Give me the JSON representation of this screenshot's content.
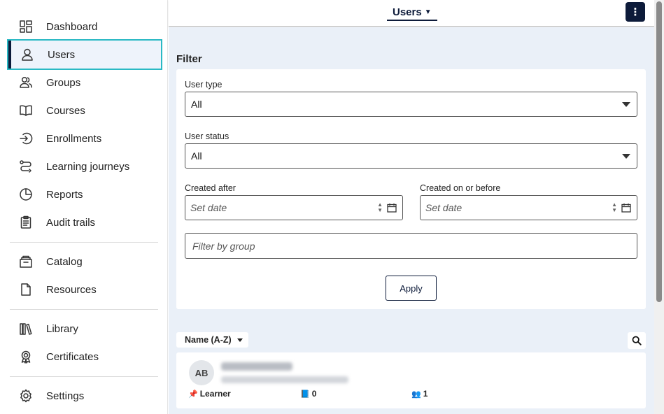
{
  "sidebar": {
    "items": [
      {
        "label": "Dashboard",
        "icon": "dashboard-icon"
      },
      {
        "label": "Users",
        "icon": "user-icon",
        "active": true
      },
      {
        "label": "Groups",
        "icon": "groups-icon"
      },
      {
        "label": "Courses",
        "icon": "book-icon"
      },
      {
        "label": "Enrollments",
        "icon": "enroll-icon"
      },
      {
        "label": "Learning journeys",
        "icon": "journey-icon"
      },
      {
        "label": "Reports",
        "icon": "pie-chart-icon"
      },
      {
        "label": "Audit trails",
        "icon": "clipboard-icon"
      },
      {
        "label": "Catalog",
        "icon": "catalog-icon"
      },
      {
        "label": "Resources",
        "icon": "file-icon"
      },
      {
        "label": "Library",
        "icon": "library-icon"
      },
      {
        "label": "Certificates",
        "icon": "certificate-icon"
      },
      {
        "label": "Settings",
        "icon": "gear-icon"
      }
    ]
  },
  "header": {
    "page_switch_label": "Users",
    "menu_button": "⋮"
  },
  "filter": {
    "title": "Filter",
    "user_type_label": "User type",
    "user_type_value": "All",
    "user_status_label": "User status",
    "user_status_value": "All",
    "created_after_label": "Created after",
    "created_after_placeholder": "Set date",
    "created_before_label": "Created on or before",
    "created_before_placeholder": "Set date",
    "group_placeholder": "Filter by group",
    "apply_label": "Apply"
  },
  "list": {
    "sort_label": "Name (A-Z)",
    "users": [
      {
        "initials": "AB",
        "role": "Learner",
        "courses": "0",
        "groups": "1"
      }
    ]
  },
  "colors": {
    "accent": "#2ab9c4",
    "navy": "#0d1b3a",
    "main_bg": "#eaf0f8"
  }
}
